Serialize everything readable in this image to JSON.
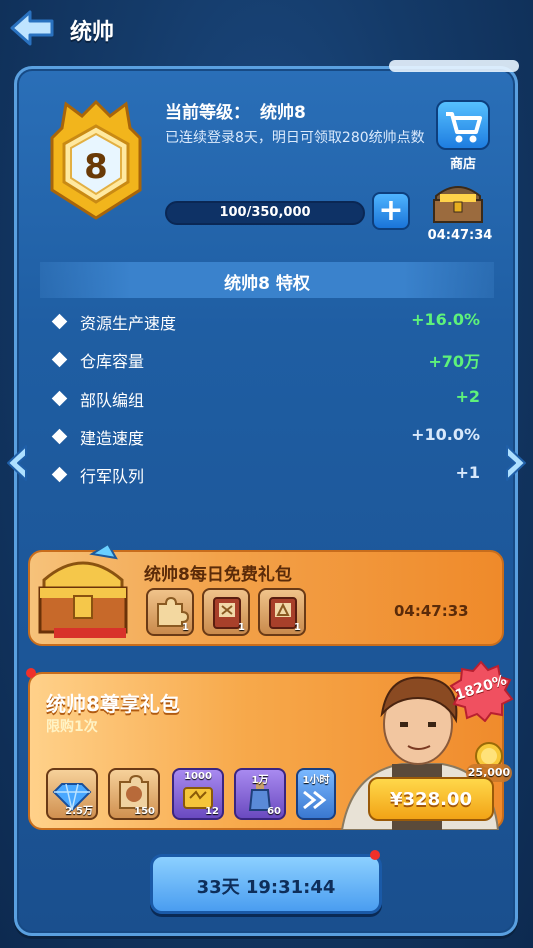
{
  "header": {
    "title": "统帅"
  },
  "commander": {
    "level_label": "当前等级：",
    "level_value": "统帅8",
    "badge_number": "8",
    "login_info": "已连续登录8天，明日可领取280统帅点数",
    "progress_text": "100/350,000",
    "progress_fraction": 0.000286,
    "shop_label": "商店",
    "chest_timer": "04:47:34"
  },
  "privileges": {
    "title": "统帅8 特权",
    "items": [
      {
        "name": "资源生产速度",
        "value": "+16.0%",
        "highlight": true
      },
      {
        "name": "仓库容量",
        "value": "+70万",
        "highlight": true
      },
      {
        "name": "部队编组",
        "value": "+2",
        "highlight": true
      },
      {
        "name": "建造速度",
        "value": "+10.0%",
        "highlight": false
      },
      {
        "name": "行军队列",
        "value": "+1",
        "highlight": false
      }
    ]
  },
  "daily_pack": {
    "title": "统帅8每日免费礼包",
    "timer": "04:47:33",
    "items": [
      {
        "icon": "puzzle-piece-icon",
        "count": "1"
      },
      {
        "icon": "red-book-icon",
        "count": "1"
      },
      {
        "icon": "red-book-icon",
        "count": "1"
      }
    ]
  },
  "exclusive_pack": {
    "title": "统帅8尊享礼包",
    "limit": "限购1次",
    "percent": "1820%",
    "coin_amount": "25,000",
    "price": "¥328.00",
    "items": [
      {
        "icon": "diamond-icon",
        "count": "2.5万",
        "top": ""
      },
      {
        "icon": "hero-shard-icon",
        "count": "150",
        "top": ""
      },
      {
        "icon": "gold-resource-icon",
        "count": "12",
        "top": "1000"
      },
      {
        "icon": "potion-icon",
        "count": "60",
        "top": "1万"
      },
      {
        "icon": "speedup-icon",
        "count": "",
        "top": "1小时"
      }
    ]
  },
  "bottom_timer": "33天 19:31:44",
  "colors": {
    "background": "#13345e",
    "panel": "#1f5ea3",
    "green_value": "#5ef27a",
    "orange_pack": "#f3a24a"
  }
}
